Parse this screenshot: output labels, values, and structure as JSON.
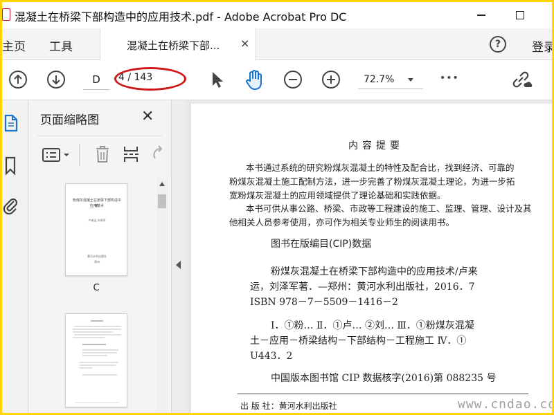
{
  "window": {
    "title": "混凝土在桥梁下部构造中的应用技术.pdf - Adobe Acrobat Pro DC"
  },
  "nav": {
    "home": "主页",
    "tools": "工具",
    "login": "登录"
  },
  "tab": {
    "label": "混凝土在桥梁下部...",
    "close": "×"
  },
  "toolbar": {
    "page_input": "D",
    "page_count": "4 / 143",
    "zoom": "72.7%",
    "more": "•••"
  },
  "panel": {
    "title": "页面缩略图",
    "close": "✕",
    "thumb1_label": "C",
    "thumb1_lines": [
      "粉煤灰混凝土在桥梁下部构造中的",
      "应用技术",
      "卢来运 刘泽军",
      "黄河水利出版社",
      "· 郑州 ·"
    ]
  },
  "document": {
    "heading": "内容提要",
    "para1": [
      "本书通过系统的研究粉煤灰混凝土的特性及配合比，找到经济、可靠的",
      "粉煤灰混凝土施工配制方法，进一步完善了粉煤灰混凝土理论，为进一步拓",
      "宽粉煤灰混凝土的应用领域提供了理论基础和实践依据。"
    ],
    "para2": [
      "本书可供从事公路、桥梁、市政等工程建设的施工、监理、管理、设计及其",
      "他相关人员参考使用，亦可作为相关专业师生的阅读用书。"
    ],
    "cip_heading": "图书在版编目(CIP)数据",
    "cip_lines": [
      "粉煤灰混凝土在桥梁下部构造中的应用技术/卢来",
      "运，刘泽军著．—郑州：黄河水利出版社，2016．7",
      "ISBN 978－7－5509－1416－2"
    ],
    "class_lines": [
      "Ⅰ．①粉…   Ⅱ．①卢…  ②刘…   Ⅲ．①粉煤灰混凝",
      "土－应用－桥梁结构－下部结构－工程施工   Ⅳ．①",
      "U443．2"
    ],
    "cip_number": "中国版本图书馆 CIP 数据核字(2016)第 088235 号",
    "publisher_line": "出  版  社：黄河水利出版社",
    "watermark": "www.cndao.com"
  },
  "colors": {
    "accent_oval": "#d01818",
    "frame": "#ffd400"
  }
}
